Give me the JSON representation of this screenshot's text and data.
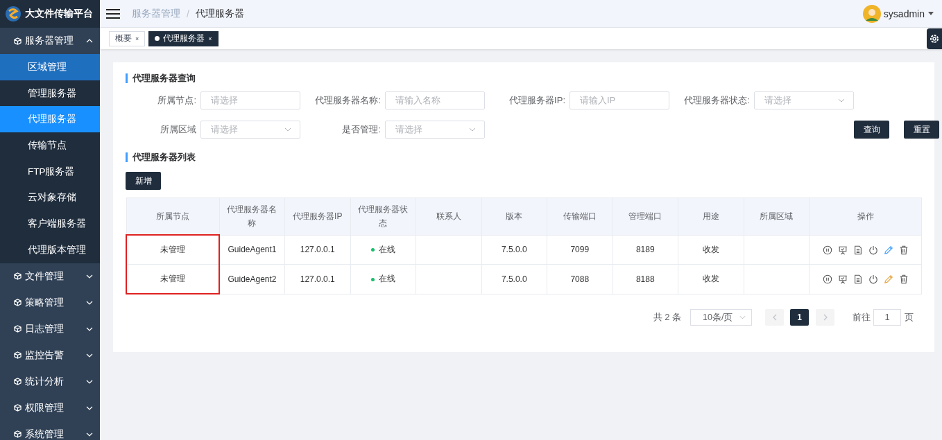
{
  "sidebar": {
    "logo_text": "大文件传输平台",
    "groups": [
      {
        "label": "服务器管理",
        "expanded": true,
        "children": [
          {
            "label": "区域管理",
            "selected": false,
            "hovered": true
          },
          {
            "label": "管理服务器",
            "selected": false,
            "hovered": false
          },
          {
            "label": "代理服务器",
            "selected": true,
            "hovered": false
          },
          {
            "label": "传输节点",
            "selected": false,
            "hovered": false
          },
          {
            "label": "FTP服务器",
            "selected": false,
            "hovered": false
          },
          {
            "label": "云对象存储",
            "selected": false,
            "hovered": false
          },
          {
            "label": "客户端服务器",
            "selected": false,
            "hovered": false
          },
          {
            "label": "代理版本管理",
            "selected": false,
            "hovered": false
          }
        ]
      },
      {
        "label": "文件管理",
        "expanded": false
      },
      {
        "label": "策略管理",
        "expanded": false
      },
      {
        "label": "日志管理",
        "expanded": false
      },
      {
        "label": "监控告警",
        "expanded": false
      },
      {
        "label": "统计分析",
        "expanded": false
      },
      {
        "label": "权限管理",
        "expanded": false
      },
      {
        "label": "系统管理",
        "expanded": false
      }
    ]
  },
  "header": {
    "breadcrumb": [
      "服务器管理",
      "代理服务器"
    ],
    "separator": "/",
    "username": "sysadmin"
  },
  "tabs": [
    {
      "label": "概要",
      "close": "×",
      "selected": false
    },
    {
      "label": "代理服务器",
      "close": "×",
      "selected": true
    }
  ],
  "query": {
    "title": "代理服务器查询",
    "fields": [
      {
        "label": "所属节点:",
        "placeholder": "请选择",
        "kind": "input"
      },
      {
        "label": "代理服务器名称:",
        "placeholder": "请输入名称",
        "kind": "input"
      },
      {
        "label": "代理服务器IP:",
        "placeholder": "请输入IP",
        "kind": "input"
      },
      {
        "label": "代理服务器状态:",
        "placeholder": "请选择",
        "kind": "select"
      },
      {
        "label": "所属区域",
        "placeholder": "请选择",
        "kind": "select"
      },
      {
        "label": "是否管理:",
        "placeholder": "请选择",
        "kind": "select"
      }
    ],
    "buttons": [
      "查询",
      "重置"
    ]
  },
  "list": {
    "title": "代理服务器列表",
    "add_button": "新增"
  },
  "table": {
    "columns": [
      {
        "label": "所属节点",
        "highlighted": true
      },
      {
        "label": "代理服务器名称",
        "highlighted": false
      },
      {
        "label": "代理服务器IP",
        "highlighted": false
      },
      {
        "label": "代理服务器状态",
        "highlighted": false
      },
      {
        "label": "联系人",
        "highlighted": false
      },
      {
        "label": "版本",
        "highlighted": false
      },
      {
        "label": "传输端口",
        "highlighted": false
      },
      {
        "label": "管理端口",
        "highlighted": false
      },
      {
        "label": "用途",
        "highlighted": false
      },
      {
        "label": "所属区域",
        "highlighted": false
      },
      {
        "label": "操作",
        "highlighted": false
      }
    ],
    "rows": [
      {
        "node": "未管理",
        "name": "GuideAgent1",
        "ip": "127.0.0.1",
        "status": {
          "text": "在线",
          "color": "#19be6b"
        },
        "version": "7.5.0.0",
        "transfer_port": "7099",
        "manage_port": "8189",
        "usage": "收发",
        "edit_icon": {
          "color": "#409eff"
        }
      },
      {
        "node": "未管理",
        "name": "GuideAgent2",
        "ip": "127.0.0.1",
        "status": {
          "text": "在线",
          "color": "#19be6b"
        },
        "version": "7.5.0.0",
        "transfer_port": "7088",
        "manage_port": "8188",
        "usage": "收发",
        "edit_icon": {
          "color": "#e6a23c"
        }
      }
    ]
  },
  "pagination": {
    "total": "共 2 条",
    "page_size": "10条/页",
    "pages": [
      {
        "label": "1",
        "selected": true
      }
    ],
    "goto_label": "前往",
    "goto_value": "1",
    "goto_suffix": "页"
  }
}
